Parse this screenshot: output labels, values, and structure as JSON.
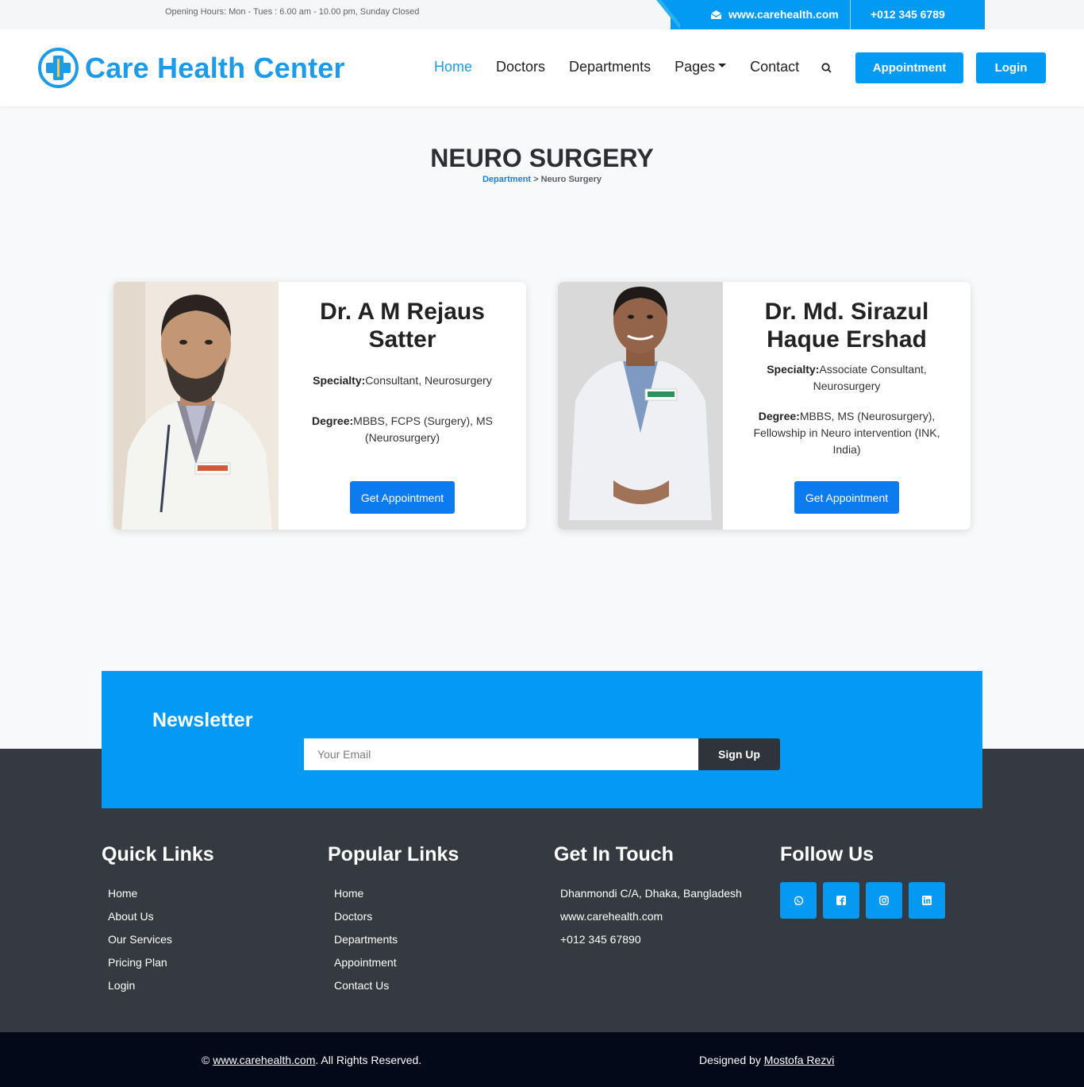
{
  "topbar": {
    "hours": "Opening Hours: Mon - Tues : 6.00 am - 10.00 pm, Sunday Closed",
    "website": "www.carehealth.com",
    "phone": "+012 345 6789"
  },
  "nav": {
    "brand": "Care Health Center",
    "links": [
      "Home",
      "Doctors",
      "Departments",
      "Pages",
      "Contact"
    ],
    "appointment_label": "Appointment",
    "login_label": "Login"
  },
  "page": {
    "title": "NEURO SURGERY",
    "breadcrumb_link": "Department",
    "breadcrumb_sep": " > ",
    "breadcrumb_current": "Neuro Surgery"
  },
  "doctors": [
    {
      "name": "Dr. A M Rejaus Satter",
      "specialty_label": "Specialty:",
      "specialty": "Consultant, Neurosurgery",
      "degree_label": "Degree:",
      "degree": "MBBS, FCPS (Surgery), MS (Neurosurgery)",
      "button": "Get Appointment"
    },
    {
      "name": "Dr. Md. Sirazul Haque Ershad",
      "specialty_label": "Specialty:",
      "specialty": "Associate Consultant, Neurosurgery",
      "degree_label": "Degree:",
      "degree": "MBBS, MS (Neurosurgery), Fellowship in Neuro intervention (INK, India)",
      "button": "Get Appointment"
    }
  ],
  "newsletter": {
    "title": "Newsletter",
    "placeholder": "Your Email",
    "button": "Sign Up"
  },
  "footer": {
    "quick_title": "Quick Links",
    "quick_links": [
      "Home",
      "About Us",
      "Our Services",
      "Pricing Plan",
      "Login"
    ],
    "popular_title": "Popular Links",
    "popular_links": [
      "Home",
      "Doctors",
      "Departments",
      "Appointment",
      "Contact Us"
    ],
    "touch_title": "Get In Touch",
    "touch_items": [
      "Dhanmondi C/A, Dhaka, Bangladesh",
      "www.carehealth.com",
      "+012 345 67890"
    ],
    "follow_title": "Follow Us",
    "social": [
      "whatsapp-icon",
      "facebook-icon",
      "instagram-icon",
      "linkedin-icon"
    ]
  },
  "bottom": {
    "copy_symbol": "© ",
    "copy_link": "www.carehealth.com",
    "copy_rest": ". All Rights Reserved.",
    "designed_by": "Designed by ",
    "designer": "Mostofa Rezvi"
  },
  "colors": {
    "primary": "#039af4",
    "brand_text": "#1e9be8",
    "footer_bg": "#353a41",
    "bottom_bg": "#04091a"
  }
}
